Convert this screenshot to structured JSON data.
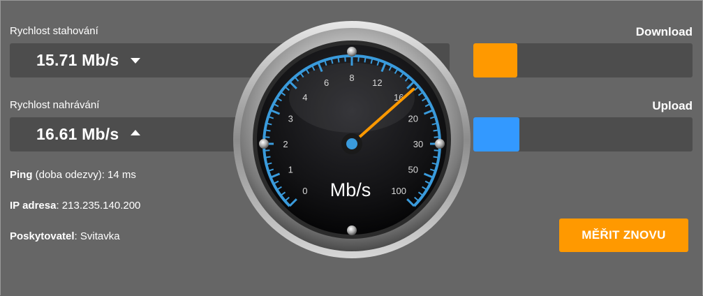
{
  "download": {
    "label": "Rychlost stahování",
    "value": "15.71 Mb/s",
    "bar_title": "Download",
    "bar_color": "#ff9900",
    "bar_fraction": 0.2
  },
  "upload": {
    "label": "Rychlost nahrávání",
    "value": "16.61 Mb/s",
    "bar_title": "Upload",
    "bar_color": "#3399ff",
    "bar_fraction": 0.21
  },
  "info": {
    "ping_label": "Ping",
    "ping_desc": " (doba odezvy): 14 ms",
    "ip_label": "IP adresa",
    "ip_value": ": 213.235.140.200",
    "provider_label": "Poskytovatel",
    "provider_value": ": Svitavka"
  },
  "button": {
    "label": "MĚŘIT ZNOVU",
    "color": "#ff9900"
  },
  "gauge": {
    "unit": "Mb/s",
    "scale": [
      "0",
      "1",
      "2",
      "3",
      "4",
      "6",
      "8",
      "12",
      "16",
      "20",
      "30",
      "50",
      "100"
    ],
    "needle_value_mbps": 16.61,
    "accent_color": "#3a9bdc",
    "needle_color": "#ff9900"
  }
}
